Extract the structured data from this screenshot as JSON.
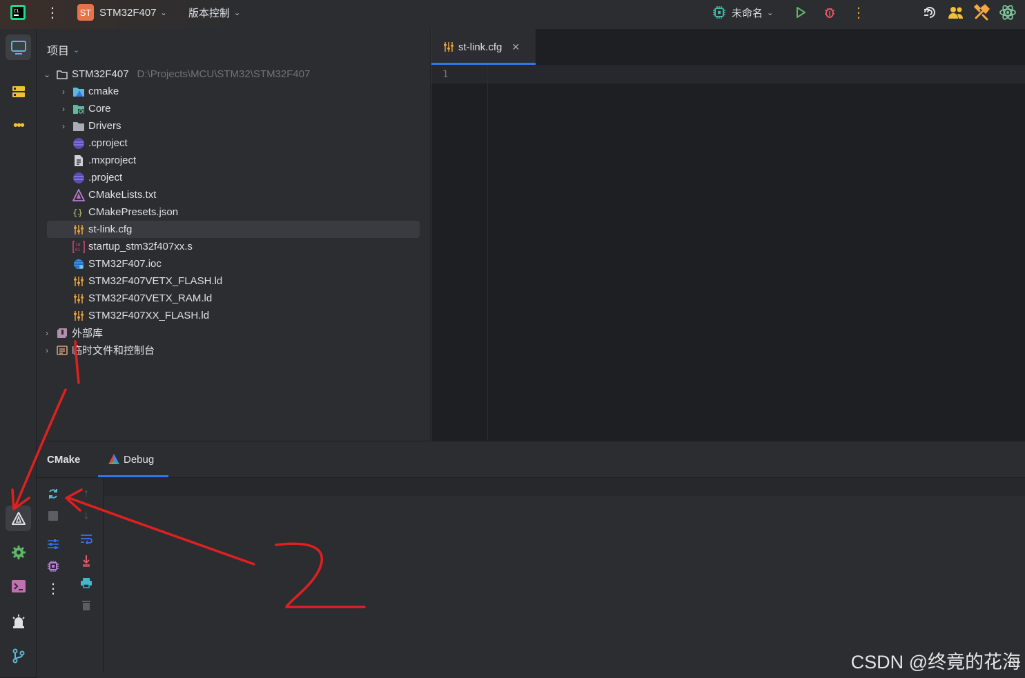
{
  "topbar": {
    "project_badge": "ST",
    "project_name": "STM32F407",
    "vcs_label": "版本控制",
    "run_config": "未命名"
  },
  "project_panel": {
    "title": "项目",
    "root": {
      "name": "STM32F407",
      "path": "D:\\Projects\\MCU\\STM32\\STM32F407"
    },
    "items": [
      {
        "name": "cmake",
        "icon": "folder-cmake-icon"
      },
      {
        "name": "Core",
        "icon": "folder-source-icon"
      },
      {
        "name": "Drivers",
        "icon": "folder-icon"
      },
      {
        "name": ".cproject",
        "icon": "eclipse-file-icon"
      },
      {
        "name": ".mxproject",
        "icon": "text-file-icon"
      },
      {
        "name": ".project",
        "icon": "eclipse-file-icon"
      },
      {
        "name": "CMakeLists.txt",
        "icon": "cmake-icon"
      },
      {
        "name": "CMakePresets.json",
        "icon": "json-icon"
      },
      {
        "name": "st-link.cfg",
        "icon": "config-icon"
      },
      {
        "name": "startup_stm32f407xx.s",
        "icon": "assembly-icon"
      },
      {
        "name": "STM32F407.ioc",
        "icon": "cubemx-icon"
      },
      {
        "name": "STM32F407VETX_FLASH.ld",
        "icon": "config-icon"
      },
      {
        "name": "STM32F407VETX_RAM.ld",
        "icon": "config-icon"
      },
      {
        "name": "STM32F407XX_FLASH.ld",
        "icon": "config-icon"
      }
    ],
    "external_libs": "外部库",
    "scratches": "临时文件和控制台"
  },
  "editor": {
    "tab_label": "st-link.cfg",
    "line_number": "1"
  },
  "bottom_panel": {
    "tab_cmake": "CMake",
    "tab_debug": "Debug"
  },
  "annotation": {
    "number": "2"
  },
  "watermark": "CSDN @终竟的花海",
  "colors": {
    "accent": "#3574f0",
    "annotation_red": "#e02020",
    "selection": "#393b40"
  }
}
